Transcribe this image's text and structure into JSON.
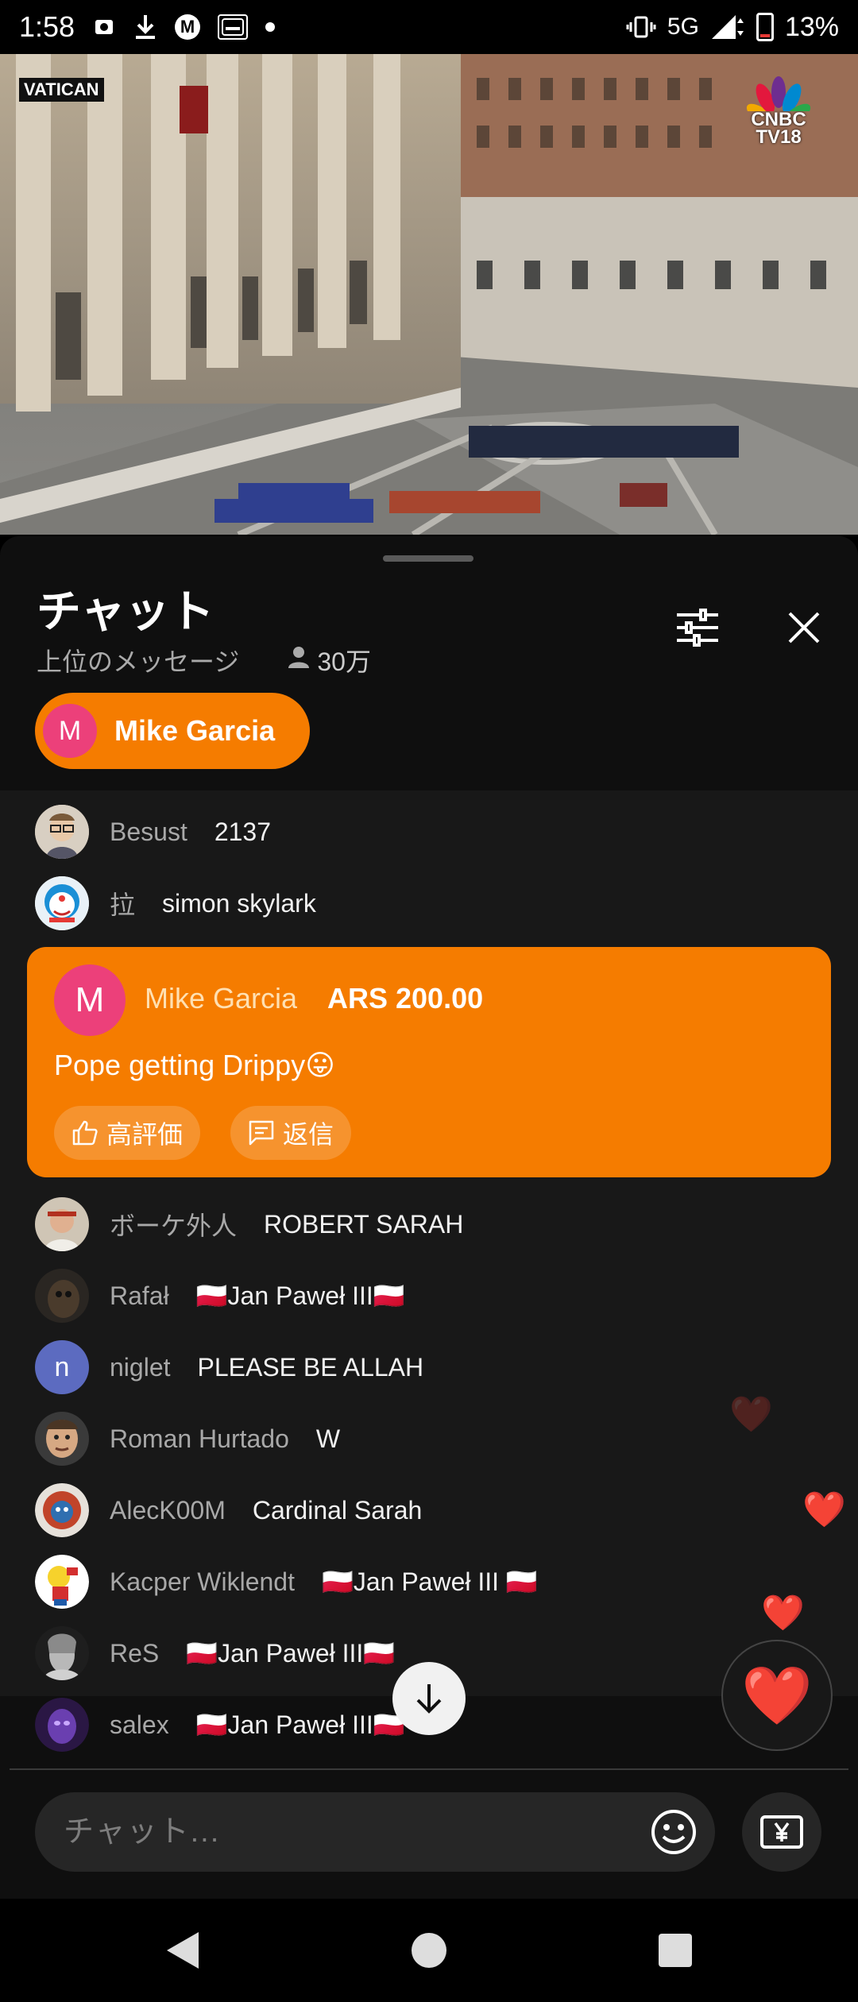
{
  "status_bar": {
    "time": "1:58",
    "network": "5G",
    "battery": "13%"
  },
  "video": {
    "location_tag": "VATICAN",
    "channel_logo_line1": "CNBC",
    "channel_logo_line2": "TV18"
  },
  "chat": {
    "title": "チャット",
    "mode": "上位のメッセージ",
    "viewers": "30万",
    "pinned": {
      "initial": "M",
      "name": "Mike Garcia"
    },
    "messages_top": [
      {
        "author": "Besust",
        "text": "2137",
        "avatar": "photo"
      },
      {
        "author": "拉",
        "text": "simon skylark",
        "avatar": "cartoon"
      }
    ],
    "superchat": {
      "initial": "M",
      "author": "Mike Garcia",
      "amount": "ARS 200.00",
      "text": "Pope getting Drippy😛",
      "like_label": "高評価",
      "reply_label": "返信"
    },
    "messages_bottom": [
      {
        "author": "ボーケ外人",
        "text": "ROBERT SARAH"
      },
      {
        "author": "Rafał",
        "text": "🇵🇱Jan Paweł III🇵🇱"
      },
      {
        "author": "niglet",
        "text": "PLEASE BE ALLAH",
        "initial": "n"
      },
      {
        "author": "Roman Hurtado",
        "text": "W"
      },
      {
        "author": "AlecK00M",
        "text": "Cardinal Sarah"
      },
      {
        "author": "Kacper Wiklendt",
        "text": "🇵🇱Jan Paweł III 🇵🇱"
      },
      {
        "author": "ReS",
        "text": "🇵🇱Jan Paweł III🇵🇱"
      },
      {
        "author": "salex",
        "text": "🇵🇱Jan Paweł III🇵🇱"
      }
    ],
    "input_placeholder": "チャット...",
    "reaction_emoji": "❤️"
  },
  "colors": {
    "accent": "#f57c00",
    "avatar_pink": "#ec407a",
    "avatar_indigo": "#5c6bc0"
  }
}
